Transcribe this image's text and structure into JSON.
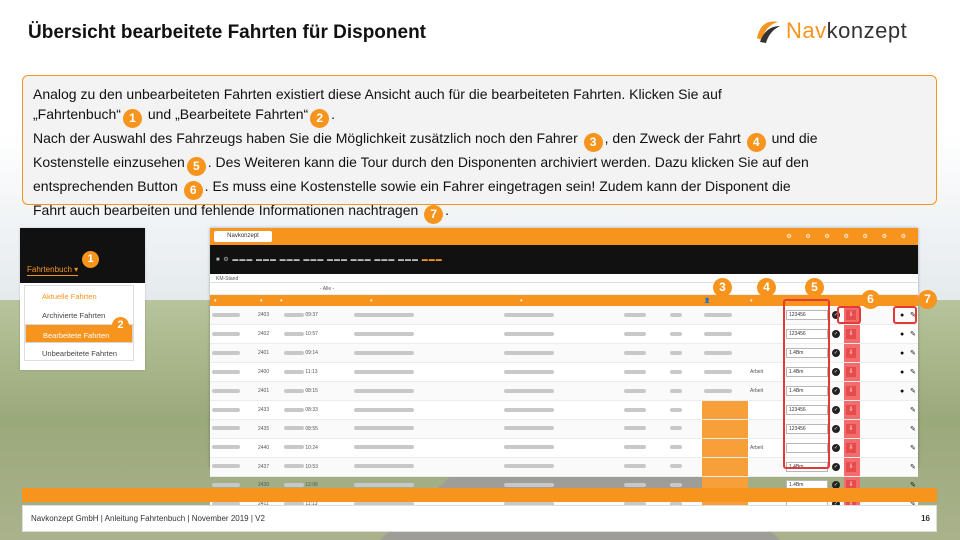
{
  "title": "Übersicht bearbeitete Fahrten für Disponent",
  "logo": {
    "prefix": "Nav",
    "suffix": "konzept"
  },
  "info": {
    "line1": "Analog zu den unbearbeiteten Fahrten existiert diese Ansicht auch für die bearbeiteten Fahrten. Klicken Sie auf",
    "l2a": "„Fahrtenbuch“",
    "l2b": " und „Bearbeitete Fahrten“",
    "l2c": ".",
    "l3a": "Nach der Auswahl des Fahrzeugs haben Sie die Möglichkeit zusätzlich noch den Fahrer",
    "l3b": ", den Zweck der Fahrt",
    "l3c": " und die",
    "l4a": "Kostenstelle einzusehen",
    "l4b": ". Des Weiteren kann die Tour durch den Disponenten archiviert werden. Dazu klicken Sie auf den",
    "l5a": "entsprechenden Button",
    "l5b": ". Es muss eine Kostenstelle sowie ein Fahrer eingetragen sein! Zudem kann der Disponent die",
    "l6a": "Fahrt auch bearbeiten und fehlende Informationen nachtragen",
    "l6b": "."
  },
  "numbers": [
    "1",
    "2",
    "3",
    "4",
    "5",
    "6",
    "7"
  ],
  "menu": {
    "tab": "Fahrtenbuch ▾",
    "items": [
      "Aktuelle Fahrten",
      "Archivierte Fahrten",
      "Bearbeitete Fahrten",
      "Unbearbeitete Fahrten"
    ]
  },
  "app": {
    "brand": "Navkonzept",
    "filter_value": "- Alle -",
    "tab_label": "KM-Stand",
    "rows": [
      {
        "nr": "2403",
        "zeit": "09:37",
        "ks": "123456",
        "zweck": "",
        "driver": true,
        "orange": false,
        "ks_empty": false
      },
      {
        "nr": "2402",
        "zeit": "10:57",
        "ks": "123456",
        "zweck": "",
        "driver": true,
        "orange": false,
        "ks_empty": false
      },
      {
        "nr": "2401",
        "zeit": "09:14",
        "ks": "1.4Bm",
        "zweck": "",
        "driver": true,
        "orange": false,
        "ks_empty": false
      },
      {
        "nr": "2400",
        "zeit": "11:13",
        "ks": "1.4Bm",
        "zweck": "Arbeit",
        "driver": true,
        "orange": false,
        "ks_empty": false
      },
      {
        "nr": "2401",
        "zeit": "08:15",
        "ks": "1.4Bm",
        "zweck": "Arbeit",
        "driver": true,
        "orange": false,
        "ks_empty": false
      },
      {
        "nr": "2433",
        "zeit": "08:33",
        "ks": "123456",
        "zweck": "",
        "driver": false,
        "orange": true,
        "ks_empty": false
      },
      {
        "nr": "2435",
        "zeit": "08:55",
        "ks": "123456",
        "zweck": "",
        "driver": false,
        "orange": true,
        "ks_empty": false
      },
      {
        "nr": "2440",
        "zeit": "10:24",
        "ks": "",
        "zweck": "Arbeit",
        "driver": false,
        "orange": true,
        "ks_empty": true
      },
      {
        "nr": "2437",
        "zeit": "10:53",
        "ks": "1.4Bm",
        "zweck": "",
        "driver": false,
        "orange": true,
        "ks_empty": false
      },
      {
        "nr": "2430",
        "zeit": "12:06",
        "ks": "1.4Bm",
        "zweck": "",
        "driver": false,
        "orange": true,
        "ks_empty": false
      },
      {
        "nr": "2411",
        "zeit": "11:13",
        "ks": "",
        "zweck": "",
        "driver": false,
        "orange": true,
        "ks_empty": true
      }
    ]
  },
  "footer": {
    "text": "Navkonzept GmbH | Anleitung Fahrtenbuch | November 2019 | V2",
    "page": "16"
  }
}
